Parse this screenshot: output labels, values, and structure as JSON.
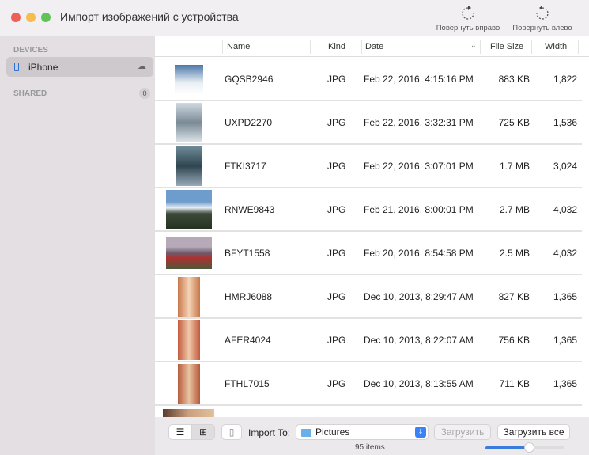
{
  "window": {
    "title": "Импорт изображений с устройства"
  },
  "toolbar": {
    "rotate_right": "Повернуть вправо",
    "rotate_left": "Повернуть влево"
  },
  "sidebar": {
    "devices_header": "DEVICES",
    "device": "iPhone",
    "shared_header": "SHARED",
    "shared_count": "0"
  },
  "columns": {
    "name": "Name",
    "kind": "Kind",
    "date": "Date",
    "size": "File Size",
    "width": "Width"
  },
  "rows": [
    {
      "name": "GQSB2946",
      "kind": "JPG",
      "date": "Feb 22, 2016, 4:15:16 PM",
      "size": "883 KB",
      "width": "1,822"
    },
    {
      "name": "UXPD2270",
      "kind": "JPG",
      "date": "Feb 22, 2016, 3:32:31 PM",
      "size": "725 KB",
      "width": "1,536"
    },
    {
      "name": "FTKI3717",
      "kind": "JPG",
      "date": "Feb 22, 2016, 3:07:01 PM",
      "size": "1.7 MB",
      "width": "3,024"
    },
    {
      "name": "RNWE9843",
      "kind": "JPG",
      "date": "Feb 21, 2016, 8:00:01 PM",
      "size": "2.7 MB",
      "width": "4,032"
    },
    {
      "name": "BFYT1558",
      "kind": "JPG",
      "date": "Feb 20, 2016, 8:54:58 PM",
      "size": "2.5 MB",
      "width": "4,032"
    },
    {
      "name": "HMRJ6088",
      "kind": "JPG",
      "date": "Dec 10, 2013, 8:29:47 AM",
      "size": "827 KB",
      "width": "1,365"
    },
    {
      "name": "AFER4024",
      "kind": "JPG",
      "date": "Dec 10, 2013, 8:22:07 AM",
      "size": "756 KB",
      "width": "1,365"
    },
    {
      "name": "FTHL7015",
      "kind": "JPG",
      "date": "Dec 10, 2013, 8:13:55 AM",
      "size": "711 KB",
      "width": "1,365"
    }
  ],
  "bottom": {
    "import_to": "Import To:",
    "destination": "Pictures",
    "import_button": "Загрузить",
    "import_all_button": "Загрузить все",
    "item_count": "95 items",
    "thumbnail_size_percent": 55
  }
}
